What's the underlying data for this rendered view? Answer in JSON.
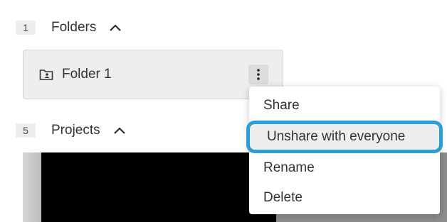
{
  "folders_section": {
    "count": "1",
    "title": "Folders",
    "toggle_icon": "chevron-up-icon"
  },
  "folder_card": {
    "icon": "folder-shared-icon",
    "name": "Folder 1",
    "menu_icon": "kebab-menu-icon"
  },
  "projects_section": {
    "count": "5",
    "title": "Projects",
    "toggle_icon": "chevron-up-icon"
  },
  "context_menu": {
    "items": [
      {
        "label": "Share"
      },
      {
        "label": "Unshare with everyone",
        "highlighted": true
      },
      {
        "label": "Rename"
      },
      {
        "label": "Delete"
      }
    ],
    "highlight_color": "#2e9ed0"
  }
}
